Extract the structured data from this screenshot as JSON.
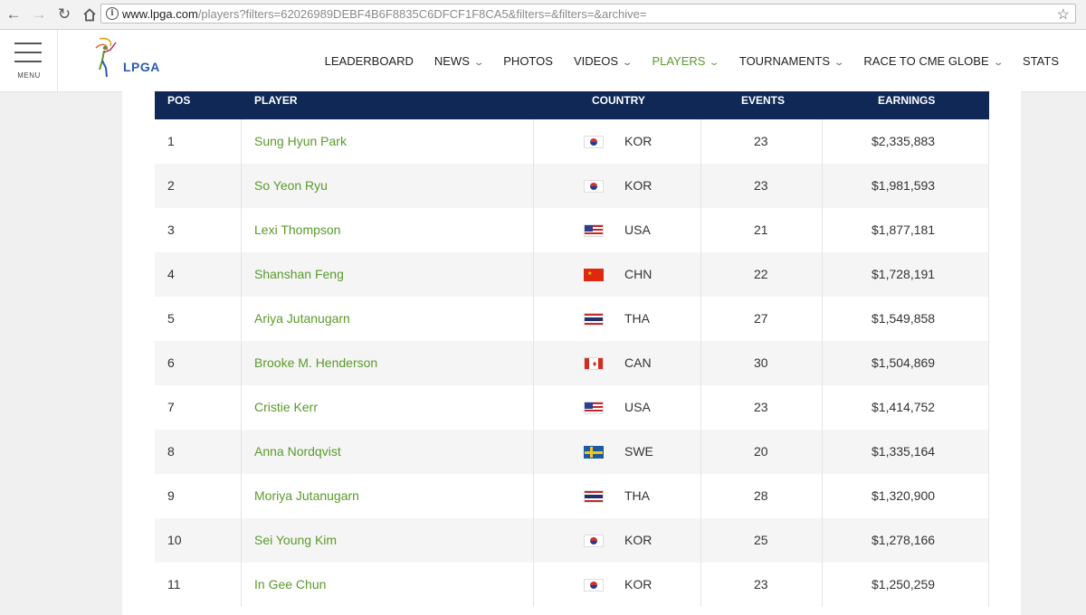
{
  "browser": {
    "url_host": "www.lpga.com",
    "url_rest": "/players?filters=62026989DEBF4B6F8835C6DFCF1F8CA5&filters=&filters=&archive="
  },
  "header": {
    "menu_label": "MENU",
    "logo_text": "LPGA",
    "nav": [
      {
        "label": "LEADERBOARD"
      },
      {
        "label": "NEWS"
      },
      {
        "label": "PHOTOS"
      },
      {
        "label": "VIDEOS"
      },
      {
        "label": "PLAYERS"
      },
      {
        "label": "TOURNAMENTS"
      },
      {
        "label": "RACE TO CME GLOBE"
      },
      {
        "label": "STATS"
      }
    ],
    "active_color": "#5a9a2a"
  },
  "table": {
    "columns": {
      "pos": "POS",
      "player": "PLAYER",
      "country": "COUNTRY",
      "events": "EVENTS",
      "earnings": "EARNINGS"
    },
    "header_color": "#0f2855",
    "rows": [
      {
        "pos": "1",
        "player": "Sung Hyun Park",
        "country": "KOR",
        "flag": "kor",
        "events": "23",
        "earnings": "$2,335,883"
      },
      {
        "pos": "2",
        "player": "So Yeon Ryu",
        "country": "KOR",
        "flag": "kor",
        "events": "23",
        "earnings": "$1,981,593"
      },
      {
        "pos": "3",
        "player": "Lexi Thompson",
        "country": "USA",
        "flag": "usa",
        "events": "21",
        "earnings": "$1,877,181"
      },
      {
        "pos": "4",
        "player": "Shanshan Feng",
        "country": "CHN",
        "flag": "chn",
        "events": "22",
        "earnings": "$1,728,191"
      },
      {
        "pos": "5",
        "player": "Ariya Jutanugarn",
        "country": "THA",
        "flag": "tha",
        "events": "27",
        "earnings": "$1,549,858"
      },
      {
        "pos": "6",
        "player": "Brooke M. Henderson",
        "country": "CAN",
        "flag": "can",
        "events": "30",
        "earnings": "$1,504,869"
      },
      {
        "pos": "7",
        "player": "Cristie Kerr",
        "country": "USA",
        "flag": "usa",
        "events": "23",
        "earnings": "$1,414,752"
      },
      {
        "pos": "8",
        "player": "Anna Nordqvist",
        "country": "SWE",
        "flag": "swe",
        "events": "20",
        "earnings": "$1,335,164"
      },
      {
        "pos": "9",
        "player": "Moriya Jutanugarn",
        "country": "THA",
        "flag": "tha",
        "events": "28",
        "earnings": "$1,320,900"
      },
      {
        "pos": "10",
        "player": "Sei Young Kim",
        "country": "KOR",
        "flag": "kor",
        "events": "25",
        "earnings": "$1,278,166"
      },
      {
        "pos": "11",
        "player": "In Gee Chun",
        "country": "KOR",
        "flag": "kor",
        "events": "23",
        "earnings": "$1,250,259"
      }
    ]
  }
}
